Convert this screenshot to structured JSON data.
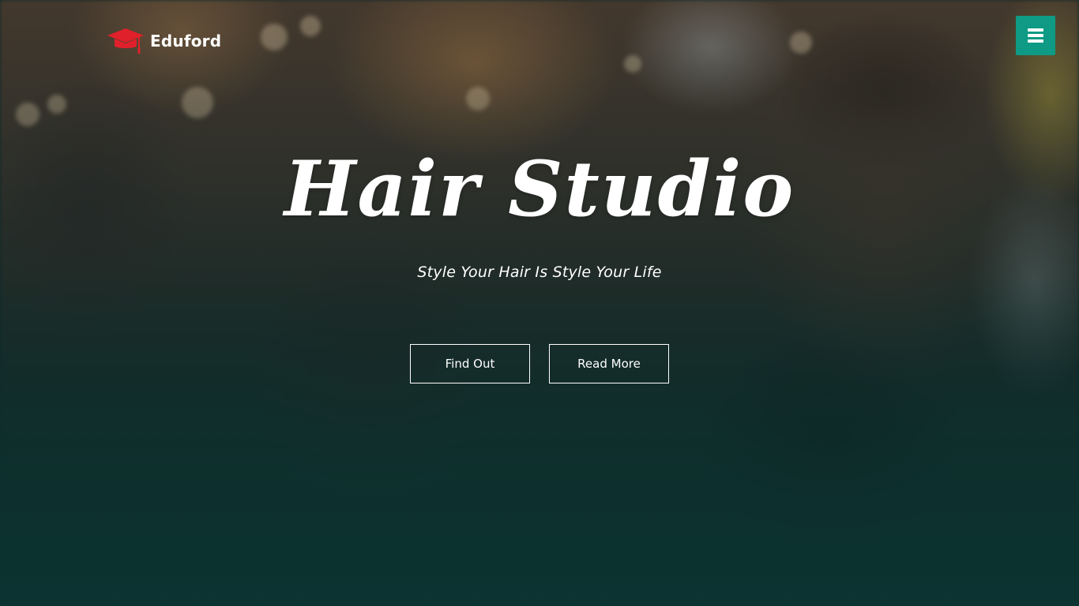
{
  "brand": {
    "name": "Eduford",
    "icon": "graduation-cap-icon",
    "icon_color": "#e0202a"
  },
  "nav": {
    "menu_icon": "hamburger-menu-icon",
    "menu_color": "#0e9a84"
  },
  "hero": {
    "title": "Hair Studio",
    "subtitle": "Style Your Hair Is Style Your Life",
    "buttons": [
      {
        "label": "Find Out"
      },
      {
        "label": "Read More"
      }
    ]
  }
}
